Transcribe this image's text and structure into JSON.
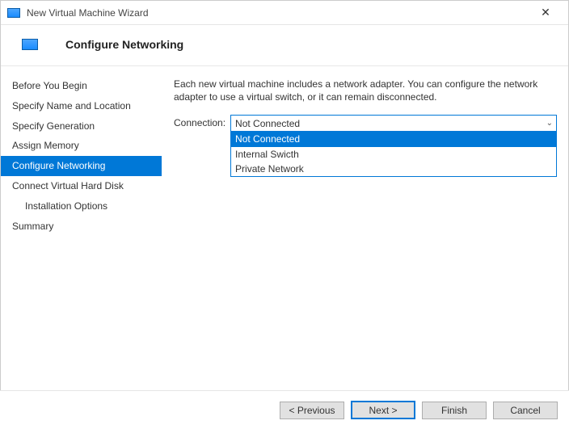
{
  "window": {
    "title": "New Virtual Machine Wizard"
  },
  "header": {
    "title": "Configure Networking"
  },
  "steps": [
    {
      "label": "Before You Begin"
    },
    {
      "label": "Specify Name and Location"
    },
    {
      "label": "Specify Generation"
    },
    {
      "label": "Assign Memory"
    },
    {
      "label": "Configure Networking"
    },
    {
      "label": "Connect Virtual Hard Disk"
    },
    {
      "label": "Installation Options"
    },
    {
      "label": "Summary"
    }
  ],
  "content": {
    "description": "Each new virtual machine includes a network adapter. You can configure the network adapter to use a virtual switch, or it can remain disconnected.",
    "connection_label": "Connection:",
    "connection_value": "Not Connected",
    "connection_options": [
      "Not Connected",
      "Internal Swicth",
      "Private Network"
    ]
  },
  "buttons": {
    "previous": "< Previous",
    "next": "Next >",
    "finish": "Finish",
    "cancel": "Cancel"
  }
}
